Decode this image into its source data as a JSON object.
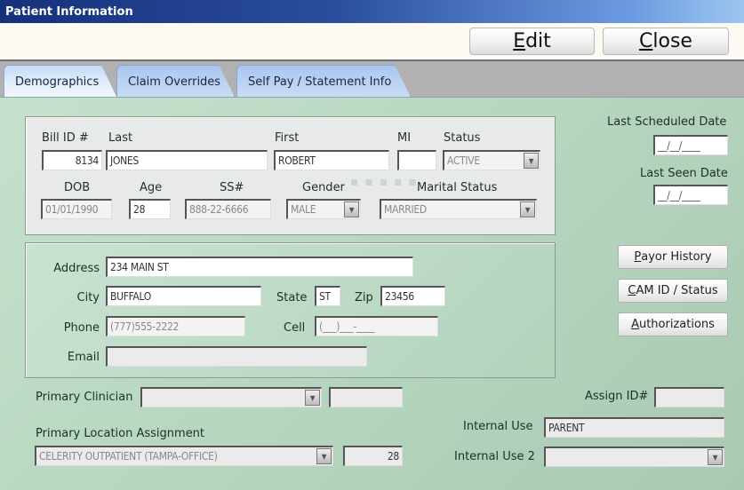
{
  "window": {
    "title": "Patient Information"
  },
  "toolbar": {
    "edit": {
      "hotkey": "E",
      "rest": "dit"
    },
    "close": {
      "hotkey": "C",
      "rest": "lose"
    }
  },
  "tabs": [
    {
      "label": "Demographics",
      "active": true
    },
    {
      "label": "Claim Overrides",
      "active": false
    },
    {
      "label": "Self Pay / Statement Info",
      "active": false
    }
  ],
  "demographics": {
    "labels": {
      "bill_id": "Bill ID #",
      "last": "Last",
      "first": "First",
      "mi": "MI",
      "status": "Status",
      "dob": "DOB",
      "age": "Age",
      "ssn": "SS#",
      "gender": "Gender",
      "marital_status": "Marital Status"
    },
    "values": {
      "bill_id": "8134",
      "last": "JONES",
      "first": "ROBERT",
      "mi": "",
      "status": "ACTIVE",
      "dob": "01/01/1990",
      "age": "28",
      "ssn": "888-22-6666",
      "gender": "MALE",
      "marital_status": "MARRIED"
    }
  },
  "dates": {
    "last_scheduled_label": "Last Scheduled Date",
    "last_scheduled_value": "__/__/____",
    "last_seen_label": "Last Seen Date",
    "last_seen_value": "__/__/____"
  },
  "contact": {
    "labels": {
      "address": "Address",
      "city": "City",
      "state": "State",
      "zip": "Zip",
      "phone": "Phone",
      "cell": "Cell",
      "email": "Email"
    },
    "values": {
      "address": "234 MAIN ST",
      "city": "BUFFALO",
      "state": "ST",
      "zip": "23456",
      "phone": "(777)555-2222",
      "cell": "(___)___-____",
      "email": ""
    }
  },
  "side_buttons": [
    {
      "hotkey": "P",
      "rest": "ayor History"
    },
    {
      "hotkey": "C",
      "rest": "AM ID / Status"
    },
    {
      "hotkey": "A",
      "rest": "uthorizations"
    }
  ],
  "assignment": {
    "primary_clinician_label": "Primary Clinician",
    "primary_clinician_value": "",
    "primary_clinician_code": "",
    "primary_location_label": "Primary Location Assignment",
    "primary_location_value": "CELERITY OUTPATIENT (TAMPA-OFFICE)",
    "primary_location_code": "28",
    "assign_id_label": "Assign ID#",
    "assign_id_value": "",
    "internal_use_label": "Internal Use",
    "internal_use_value": "PARENT",
    "internal_use2_label": "Internal Use 2",
    "internal_use2_value": ""
  },
  "icons": {
    "dropdown": "chevron-down-icon"
  }
}
